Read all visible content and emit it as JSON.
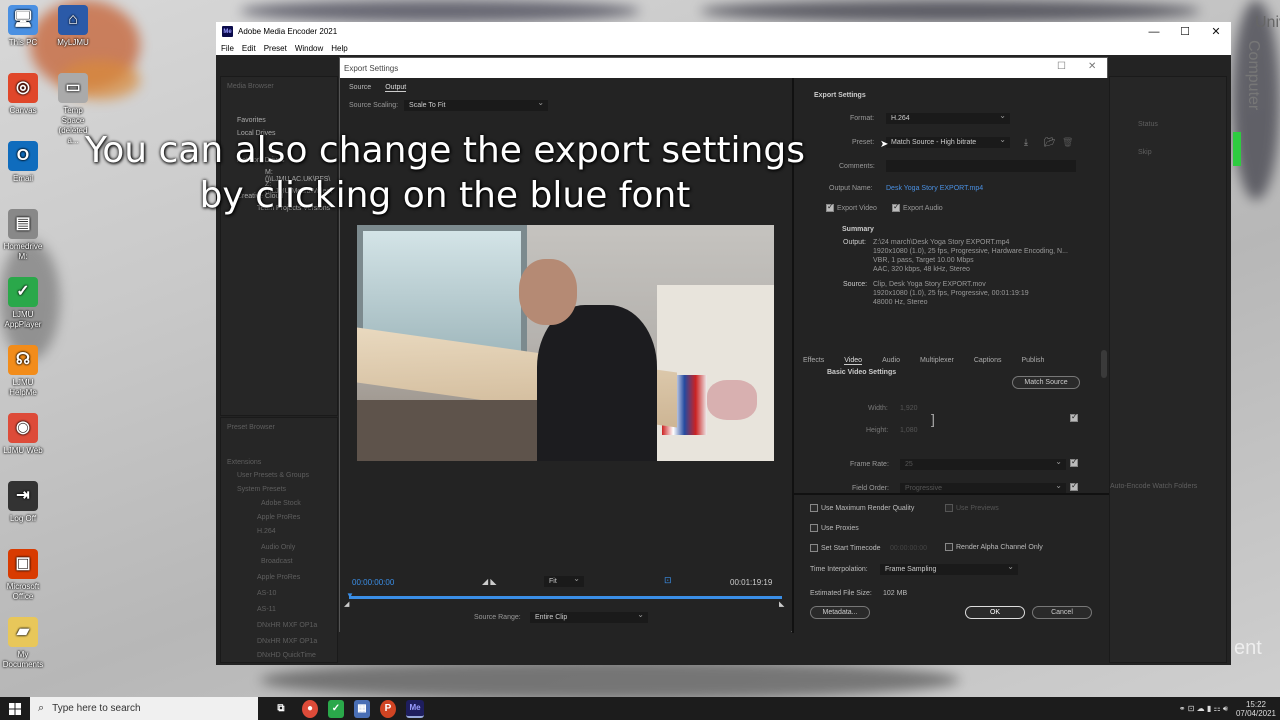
{
  "desktop": {
    "icons": [
      {
        "label": "This PC",
        "icon": "computer-icon",
        "color": "#4a90e2"
      },
      {
        "label": "MyLJMU",
        "icon": "myljmu-icon",
        "color": "#2b5aa8"
      },
      {
        "label": "Canvas",
        "icon": "canvas-icon",
        "color": "#e0472a"
      },
      {
        "label": "Temp Space (deleted a...",
        "icon": "drive-icon",
        "color": "#aaaaaa"
      },
      {
        "label": "Email",
        "icon": "outlook-icon",
        "color": "#0f6cbd"
      },
      {
        "label": "Homedrive M:",
        "icon": "network-drive-icon",
        "color": "#888888"
      },
      {
        "label": "LJMU AppPlayer",
        "icon": "appplayer-icon",
        "color": "#2aa84a"
      },
      {
        "label": "LJMU HelpMe",
        "icon": "headset-icon",
        "color": "#f28c1a"
      },
      {
        "label": "LJMU Web",
        "icon": "chrome-icon",
        "color": "#dd4b39"
      },
      {
        "label": "Log Off",
        "icon": "logoff-icon",
        "color": "#333333"
      },
      {
        "label": "Microsoft Office",
        "icon": "office-icon",
        "color": "#d83b01"
      },
      {
        "label": "My Documents",
        "icon": "folder-icon",
        "color": "#e8c75a"
      }
    ],
    "side_text_1": "Univ",
    "side_text_2": "Computer",
    "side_text_3": "ent"
  },
  "caption": {
    "line1": "You can also change the export settings",
    "line2": "by clicking on the blue font"
  },
  "ame": {
    "title": "Adobe Media Encoder 2021",
    "logo": "Me",
    "menu": [
      "File",
      "Edit",
      "Preset",
      "Window",
      "Help"
    ],
    "bg": {
      "media_browser": "Media Browser",
      "favorites": "Favorites",
      "local_drives": "Local Drives",
      "network": "Network Drives",
      "drive_m": "M: (\\\\LJMU.AC.UK\\PFS\\",
      "drive_z": "Z: (\\\\LJMU\\Media\\Video\\",
      "creative": "Creative Cloud",
      "team": "Team Projects Versions",
      "preset_browser": "Preset Browser",
      "extensions": "Extensions",
      "user_presets": "User Presets & Groups",
      "system_presets": "System Presets",
      "adobe_stock": "Adobe Stock",
      "apple_prores": "Apple ProRes",
      "h264": "H.264",
      "audio_only": "Audio Only",
      "broadcast": "Broadcast",
      "apple_prores2": "Apple ProRes",
      "as10": "AS-10",
      "as11": "AS-11",
      "dnxhr1": "DNxHR MXF OP1a",
      "dnxhr2": "DNxHR MXF OP1a",
      "dnxhd": "DNxHD QuickTime",
      "queue_status": "Status",
      "queue_skip": "Skip",
      "auto_encode": "Auto-Encode Watch Folders"
    }
  },
  "dialog": {
    "title": "Export Settings",
    "left": {
      "tabs": [
        "Source",
        "Output"
      ],
      "active_tab": "Output",
      "source_scaling_label": "Source Scaling:",
      "source_scaling_value": "Scale To Fit",
      "timecode_in": "00:00:00:00",
      "timecode_out": "00:01:19:19",
      "fit": "Fit",
      "source_range_label": "Source Range:",
      "source_range_value": "Entire Clip"
    },
    "export_settings": {
      "heading": "Export Settings",
      "format_label": "Format:",
      "format_value": "H.264",
      "preset_label": "Preset:",
      "preset_value": "Match Source - High bitrate",
      "comments_label": "Comments:",
      "output_name_label": "Output Name:",
      "output_name_value": "Desk Yoga Story EXPORT.mp4",
      "export_video": "Export Video",
      "export_audio": "Export Audio"
    },
    "summary": {
      "heading": "Summary",
      "output_label": "Output:",
      "output_lines": [
        "Z:\\24 march\\Desk Yoga Story EXPORT.mp4",
        "1920x1080 (1.0), 25 fps, Progressive, Hardware Encoding, N...",
        "VBR, 1 pass, Target 10.00 Mbps",
        "AAC, 320 kbps, 48 kHz, Stereo"
      ],
      "source_label": "Source:",
      "source_lines": [
        "Clip, Desk Yoga Story EXPORT.mov",
        "1920x1080 (1.0), 25 fps, Progressive, 00:01:19:19",
        "48000 Hz, Stereo"
      ]
    },
    "tabs": [
      "Effects",
      "Video",
      "Audio",
      "Multiplexer",
      "Captions",
      "Publish"
    ],
    "active_tab": "Video",
    "video": {
      "heading": "Basic Video Settings",
      "match_source": "Match Source",
      "width_label": "Width:",
      "width_value": "1,920",
      "height_label": "Height:",
      "height_value": "1,080",
      "frame_rate_label": "Frame Rate:",
      "frame_rate_value": "25",
      "field_order_label": "Field Order:",
      "field_order_value": "Progressive"
    },
    "bottom": {
      "max_render": "Use Maximum Render Quality",
      "use_previews": "Use Previews",
      "use_proxies": "Use Proxies",
      "set_start_tc": "Set Start Timecode",
      "start_tc_value": "00:00:00:00",
      "render_alpha": "Render Alpha Channel Only",
      "time_interp_label": "Time Interpolation:",
      "time_interp_value": "Frame Sampling",
      "est_size_label": "Estimated File Size:",
      "est_size_value": "102 MB",
      "metadata": "Metadata...",
      "ok": "OK",
      "cancel": "Cancel"
    }
  },
  "taskbar": {
    "search_placeholder": "Type here to search",
    "time": "15:22",
    "date": "07/04/2021"
  }
}
